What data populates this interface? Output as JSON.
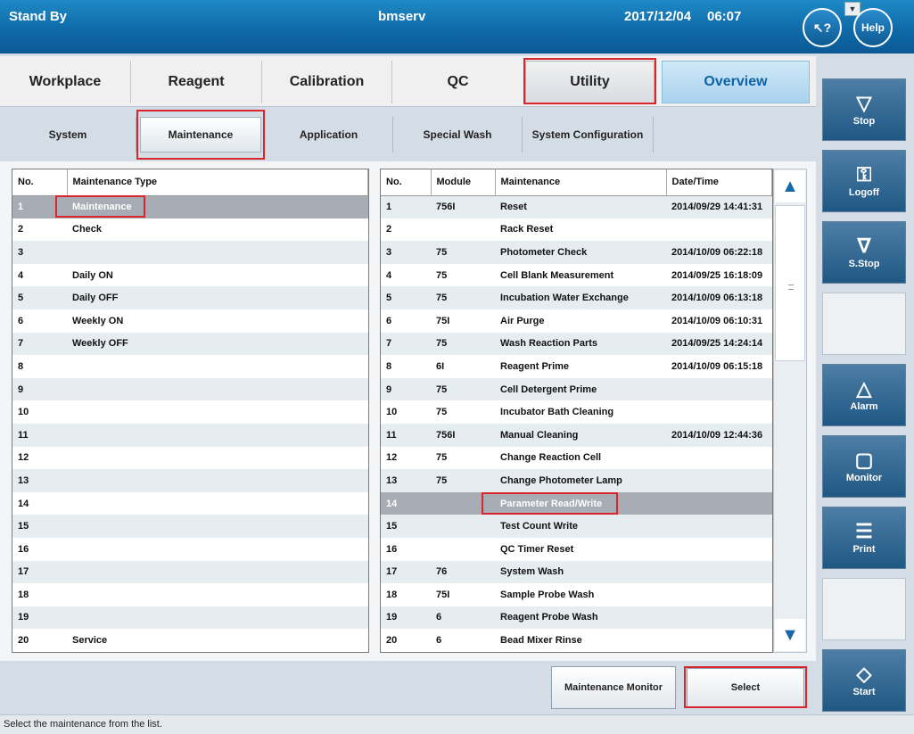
{
  "header": {
    "status": "Stand By",
    "server": "bmserv",
    "date": "2017/12/04",
    "time": "06:07",
    "whatis_label": "?",
    "help_label": "Help",
    "dropdown_label": "▼"
  },
  "main_tabs": [
    {
      "label": "Workplace"
    },
    {
      "label": "Reagent"
    },
    {
      "label": "Calibration"
    },
    {
      "label": "QC"
    },
    {
      "label": "Utility"
    },
    {
      "label": "Overview"
    }
  ],
  "sub_tabs": [
    {
      "label": "System"
    },
    {
      "label": "Maintenance"
    },
    {
      "label": "Application"
    },
    {
      "label": "Special Wash"
    },
    {
      "label": "System Configuration"
    }
  ],
  "left_table": {
    "headers": [
      "No.",
      "Maintenance Type"
    ],
    "rows": [
      {
        "no": "1",
        "type": "Maintenance"
      },
      {
        "no": "2",
        "type": "Check"
      },
      {
        "no": "3",
        "type": ""
      },
      {
        "no": "4",
        "type": "Daily ON"
      },
      {
        "no": "5",
        "type": "Daily OFF"
      },
      {
        "no": "6",
        "type": "Weekly ON"
      },
      {
        "no": "7",
        "type": "Weekly OFF"
      },
      {
        "no": "8",
        "type": ""
      },
      {
        "no": "9",
        "type": ""
      },
      {
        "no": "10",
        "type": ""
      },
      {
        "no": "11",
        "type": ""
      },
      {
        "no": "12",
        "type": ""
      },
      {
        "no": "13",
        "type": ""
      },
      {
        "no": "14",
        "type": ""
      },
      {
        "no": "15",
        "type": ""
      },
      {
        "no": "16",
        "type": ""
      },
      {
        "no": "17",
        "type": ""
      },
      {
        "no": "18",
        "type": ""
      },
      {
        "no": "19",
        "type": ""
      },
      {
        "no": "20",
        "type": "Service"
      }
    ]
  },
  "right_table": {
    "headers": [
      "No.",
      "Module",
      "Maintenance",
      "Date/Time"
    ],
    "rows": [
      {
        "no": "1",
        "module": "756I",
        "maintenance": "Reset",
        "datetime": "2014/09/29 14:41:31"
      },
      {
        "no": "2",
        "module": "",
        "maintenance": "Rack Reset",
        "datetime": ""
      },
      {
        "no": "3",
        "module": "75",
        "maintenance": "Photometer Check",
        "datetime": "2014/10/09 06:22:18"
      },
      {
        "no": "4",
        "module": "75",
        "maintenance": "Cell Blank Measurement",
        "datetime": "2014/09/25 16:18:09"
      },
      {
        "no": "5",
        "module": "75",
        "maintenance": "Incubation Water Exchange",
        "datetime": "2014/10/09 06:13:18"
      },
      {
        "no": "6",
        "module": "75I",
        "maintenance": "Air Purge",
        "datetime": "2014/10/09 06:10:31"
      },
      {
        "no": "7",
        "module": "75",
        "maintenance": "Wash Reaction Parts",
        "datetime": "2014/09/25 14:24:14"
      },
      {
        "no": "8",
        "module": "6I",
        "maintenance": "Reagent Prime",
        "datetime": "2014/10/09 06:15:18"
      },
      {
        "no": "9",
        "module": "75",
        "maintenance": "Cell Detergent Prime",
        "datetime": ""
      },
      {
        "no": "10",
        "module": "75",
        "maintenance": "Incubator Bath Cleaning",
        "datetime": ""
      },
      {
        "no": "11",
        "module": "756I",
        "maintenance": "Manual Cleaning",
        "datetime": "2014/10/09 12:44:36"
      },
      {
        "no": "12",
        "module": "75",
        "maintenance": "Change Reaction Cell",
        "datetime": ""
      },
      {
        "no": "13",
        "module": "75",
        "maintenance": "Change Photometer Lamp",
        "datetime": ""
      },
      {
        "no": "14",
        "module": "",
        "maintenance": "Parameter Read/Write",
        "datetime": ""
      },
      {
        "no": "15",
        "module": "",
        "maintenance": "Test Count Write",
        "datetime": ""
      },
      {
        "no": "16",
        "module": "",
        "maintenance": "QC Timer Reset",
        "datetime": ""
      },
      {
        "no": "17",
        "module": "76",
        "maintenance": "System Wash",
        "datetime": ""
      },
      {
        "no": "18",
        "module": "75I",
        "maintenance": "Sample Probe Wash",
        "datetime": ""
      },
      {
        "no": "19",
        "module": "6",
        "maintenance": "Reagent Probe Wash",
        "datetime": ""
      },
      {
        "no": "20",
        "module": "6",
        "maintenance": "Bead Mixer Rinse",
        "datetime": ""
      }
    ]
  },
  "buttons": {
    "maintenance_monitor": "Maintenance Monitor",
    "select": "Select"
  },
  "side_buttons": [
    {
      "label": "Stop",
      "icon": "stop-icon"
    },
    {
      "label": "Logoff",
      "icon": "key-icon"
    },
    {
      "label": "S.Stop",
      "icon": "sampling-stop-icon"
    },
    {
      "label": "Alarm",
      "icon": "bell-icon"
    },
    {
      "label": "Monitor",
      "icon": "monitor-icon"
    },
    {
      "label": "Print",
      "icon": "print-icon"
    },
    {
      "label": "Start",
      "icon": "start-icon"
    }
  ],
  "status_message": "Select the maintenance from the list.",
  "colors": {
    "title_bar": "#0f6aa8",
    "highlight_box": "#d9262c",
    "selected_row": "#a8adb5",
    "side_button": "#2a6490"
  }
}
